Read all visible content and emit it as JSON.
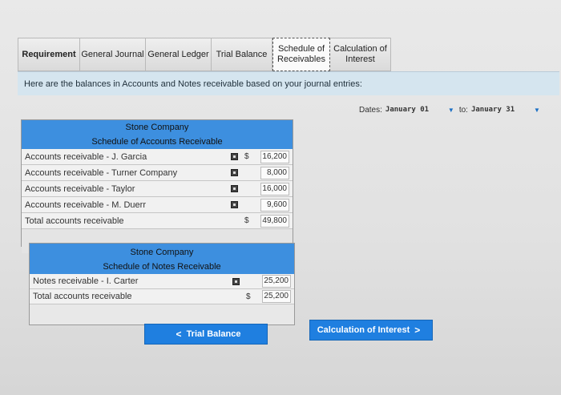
{
  "tabs": [
    {
      "label": "Requirement"
    },
    {
      "label": "General Journal"
    },
    {
      "label": "General Ledger"
    },
    {
      "label": "Trial Balance"
    },
    {
      "label": "Schedule of Receivables"
    },
    {
      "label": "Calculation of Interest"
    }
  ],
  "instruction": "Here are the balances in Accounts and Notes receivable based on your journal entries:",
  "dates": {
    "label_from": "Dates:",
    "from": "January 01",
    "label_to": "to:",
    "to": "January 31"
  },
  "schedule_ar": {
    "company": "Stone Company",
    "title": "Schedule of Accounts Receivable",
    "rows": [
      {
        "name": "Accounts receivable - J. Garcia",
        "dollar": "$",
        "amount": "16,200"
      },
      {
        "name": "Accounts receivable - Turner Company",
        "dollar": "",
        "amount": "8,000"
      },
      {
        "name": "Accounts receivable - Taylor",
        "dollar": "",
        "amount": "16,000"
      },
      {
        "name": "Accounts receivable - M. Duerr",
        "dollar": "",
        "amount": "9,600"
      }
    ],
    "total": {
      "name": "Total accounts receivable",
      "dollar": "$",
      "amount": "49,800"
    }
  },
  "schedule_nr": {
    "company": "Stone Company",
    "title": "Schedule of Notes Receivable",
    "rows": [
      {
        "name": "Notes receivable - I. Carter",
        "dollar": "",
        "amount": "25,200"
      }
    ],
    "total": {
      "name": "Total accounts receivable",
      "dollar": "$",
      "amount": "25,200"
    }
  },
  "buttons": {
    "prev": {
      "arrow": "<",
      "label": "Trial Balance"
    },
    "next": {
      "label": "Calculation of Interest",
      "arrow": ">"
    }
  },
  "colors": {
    "accent": "#1f7fe0",
    "header": "#3d8fdf",
    "instruction_bg": "#d5e5ef"
  },
  "icons": {
    "row_marker": "small-square-icon",
    "dropdown": "caret-down-icon"
  }
}
